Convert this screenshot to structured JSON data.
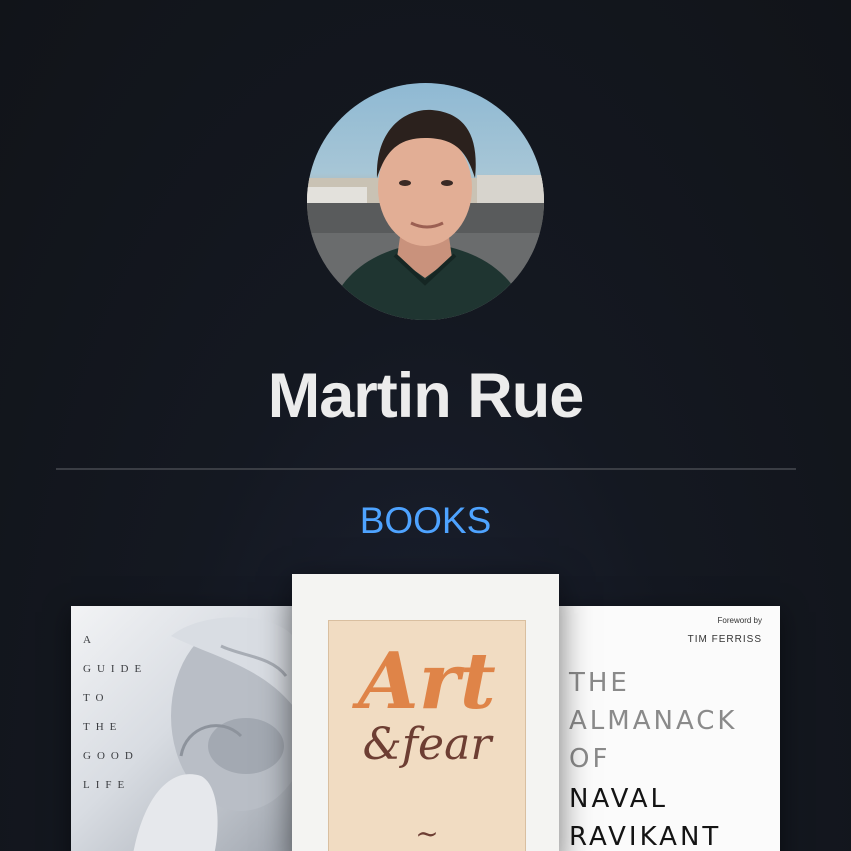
{
  "profile": {
    "name": "Martin Rue",
    "avatar_alt": "profile photo"
  },
  "section": {
    "title": "BOOKS"
  },
  "books": {
    "left": {
      "words": [
        "A",
        "GUIDE",
        "TO",
        "THE",
        "GOOD",
        "LIFE"
      ]
    },
    "center": {
      "title_art": "Art",
      "title_amp_fear": "&fear",
      "tilde": "~"
    },
    "right": {
      "foreword": "Foreword by",
      "foreword_author": "TIM FERRISS",
      "title_lines": [
        "THE",
        "ALMANACK",
        "OF",
        "NAVAL",
        "RAVIKANT"
      ]
    }
  },
  "colors": {
    "background": "#111419",
    "name": "#ececec",
    "accent": "#4ea3ff",
    "divider": "#3a3d44"
  }
}
